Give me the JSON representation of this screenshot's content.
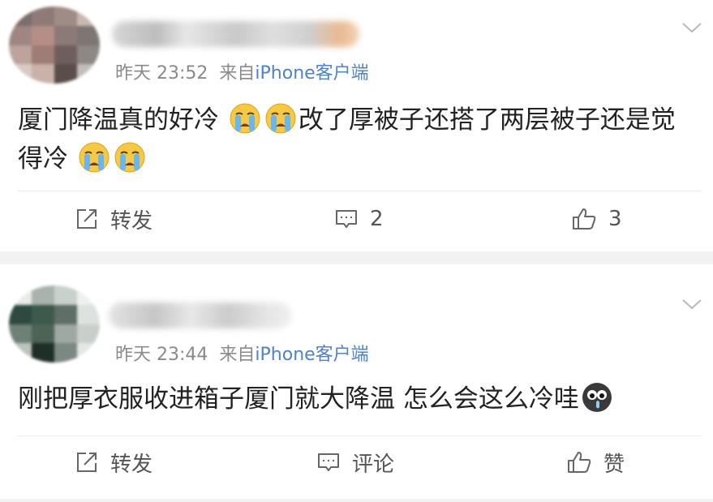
{
  "posts": [
    {
      "time": "昨天 23:52",
      "via": "来自",
      "source": "iPhone客户端",
      "text_a": "厦门降温真的好冷",
      "text_b": "改了厚被子还搭了两层被子还是觉得冷",
      "emojis": [
        "crying-emoji",
        "crying-emoji",
        "crying-emoji",
        "crying-emoji"
      ],
      "actions": {
        "share": "转发",
        "comment": "2",
        "like": "3"
      }
    },
    {
      "time": "昨天 23:44",
      "via": "来自",
      "source": "iPhone客户端",
      "text_a": "刚把厚衣服收进箱子厦门就大降温 怎么会这么冷哇",
      "emojis": [
        "cold-face-emoji"
      ],
      "actions": {
        "share": "转发",
        "comment": "评论",
        "like": "赞"
      }
    }
  ],
  "colors": {
    "source_link": "#4f82c9",
    "meta_gray": "#8a8a8a",
    "background": "#f2f2f2"
  },
  "icons": [
    "chevron-down-icon",
    "share-icon",
    "comment-icon",
    "like-icon"
  ]
}
